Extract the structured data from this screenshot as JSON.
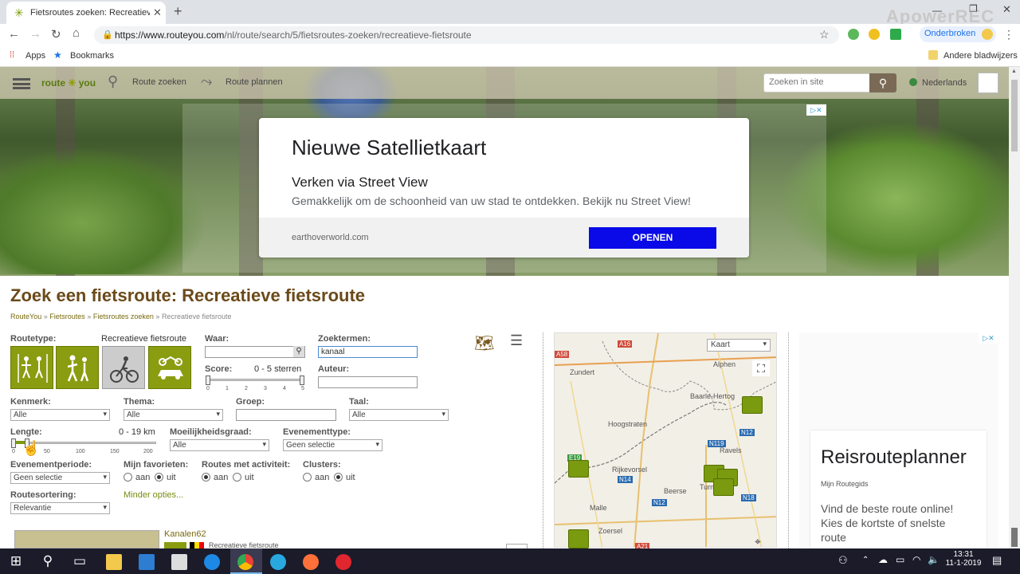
{
  "browser": {
    "tab_title": "Fietsroutes zoeken: Recreatieve f",
    "url_domain": "https://www.routeyou.com",
    "url_path": "/nl/route/search/5/fietsroutes-zoeken/recreatieve-fietsroute",
    "profile_label": "Onderbroken",
    "watermark": "ApowerREC",
    "bookmarks": [
      "Apps",
      "Bookmarks"
    ],
    "other_bookmarks": "Andere bladwijzers"
  },
  "site": {
    "logo_left": "route",
    "logo_right": "you",
    "nav": [
      "Route zoeken",
      "Route plannen"
    ],
    "search_placeholder": "Zoeken in site",
    "language": "Nederlands"
  },
  "ad": {
    "badge": "▷✕",
    "title": "Nieuwe Satellietkaart",
    "subtitle": "Verken via Street View",
    "description": "Gemakkelijk om de schoonheid van uw stad te ontdekken. Bekijk nu Street View!",
    "domain": "earthoverworld.com",
    "cta": "OPENEN"
  },
  "page": {
    "title": "Zoek een fietsroute: Recreatieve fietsroute",
    "breadcrumb": [
      "RouteYou",
      "Fietsroutes",
      "Fietsroutes zoeken",
      "Recreatieve fietsroute"
    ],
    "breadcrumb_sep": "»"
  },
  "form": {
    "routetype_label": "Routetype:",
    "routetype_value": "Recreatieve fietsroute",
    "waar_label": "Waar:",
    "zoektermen_label": "Zoektermen:",
    "zoektermen_value": "kanaal",
    "score_label": "Score:",
    "score_range": "0 - 5 sterren",
    "score_ticks": [
      "0",
      "1",
      "2",
      "3",
      "4",
      "5"
    ],
    "auteur_label": "Auteur:",
    "kenmerk_label": "Kenmerk:",
    "kenmerk_value": "Alle",
    "thema_label": "Thema:",
    "thema_value": "Alle",
    "groep_label": "Groep:",
    "taal_label": "Taal:",
    "taal_value": "Alle",
    "lengte_label": "Lengte:",
    "lengte_range": "0 - 19 km",
    "lengte_ticks": [
      "0",
      "50",
      "100",
      "150",
      "200"
    ],
    "moeilijkheid_label": "Moeilijkheidsgraad:",
    "moeilijkheid_value": "Alle",
    "evenementtype_label": "Evenementtype:",
    "evenementtype_value": "Geen selectie",
    "evenementperiode_label": "Evenementperiode:",
    "evenementperiode_value": "Geen selectie",
    "favorieten_label": "Mijn favorieten:",
    "activiteit_label": "Routes met activiteit:",
    "clusters_label": "Clusters:",
    "aan": "aan",
    "uit": "uit",
    "sortering_label": "Routesortering:",
    "sortering_value": "Relevantie",
    "minder_opties": "Minder opties..."
  },
  "result": {
    "name": "Kanalen62",
    "type": "Recreatieve fietsroute"
  },
  "map": {
    "type_select": "Kaart",
    "places": [
      "Zundert",
      "Alphen",
      "Baarle-Hertog",
      "Hoogstraten",
      "Ravels",
      "Rijkevorsel",
      "Beerse",
      "Turnhout",
      "Malle",
      "Zoersel"
    ],
    "roads": [
      "A16",
      "A58",
      "N119",
      "N12",
      "E19",
      "N14",
      "N12",
      "N18",
      "A21"
    ]
  },
  "right_ad": {
    "title": "Reisrouteplanner",
    "source": "Mijn Routegids",
    "text": "Vind de beste route online! Kies de kortste of snelste route"
  },
  "taskbar": {
    "time": "13:31",
    "date": "11-1-2019"
  }
}
